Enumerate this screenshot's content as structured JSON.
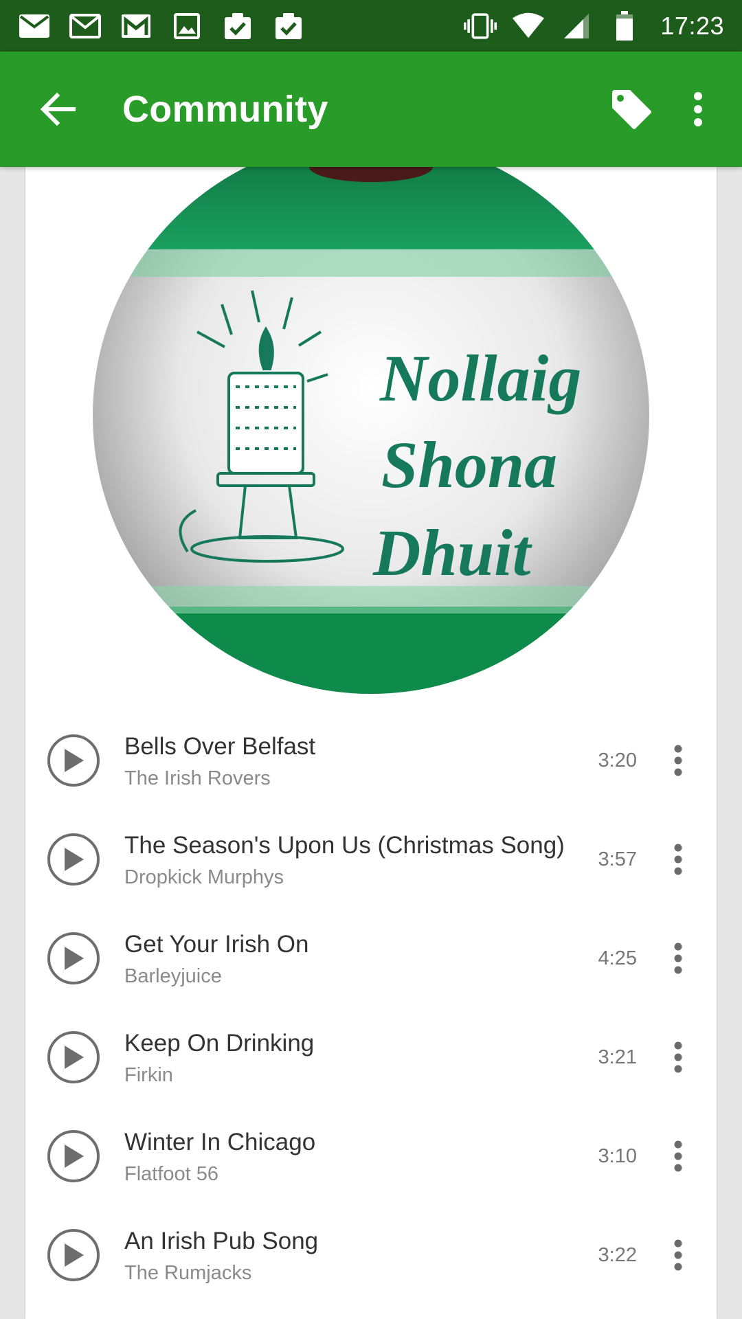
{
  "status_bar": {
    "time": "17:23",
    "left_icons": [
      "mail-icon",
      "mail-icon",
      "gmail-icon",
      "image-icon",
      "clipboard-check-icon",
      "clipboard-check-icon"
    ],
    "right_icons": [
      "vibrate-icon",
      "wifi-icon",
      "signal-icon",
      "battery-icon"
    ]
  },
  "toolbar": {
    "title": "Community",
    "bg_color": "#289b28",
    "status_color": "#1e5c1c"
  },
  "artwork": {
    "text_lines": [
      "Nollaig",
      "Shona",
      "Dhuit"
    ]
  },
  "tracks": [
    {
      "title": "Bells Over Belfast",
      "artist": "The Irish Rovers",
      "duration": "3:20"
    },
    {
      "title": "The Season's Upon Us (Christmas Song)",
      "artist": "Dropkick Murphys",
      "duration": "3:57"
    },
    {
      "title": "Get Your Irish On",
      "artist": "Barleyjuice",
      "duration": "4:25"
    },
    {
      "title": "Keep On Drinking",
      "artist": "Firkin",
      "duration": "3:21"
    },
    {
      "title": "Winter In Chicago",
      "artist": "Flatfoot 56",
      "duration": "3:10"
    },
    {
      "title": "An Irish Pub Song",
      "artist": "The Rumjacks",
      "duration": "3:22"
    }
  ]
}
